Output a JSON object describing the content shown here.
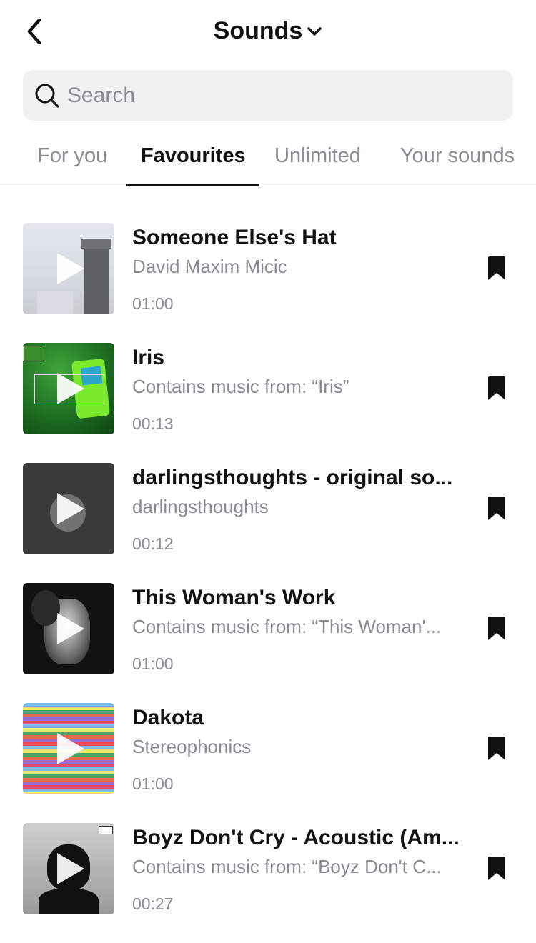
{
  "header": {
    "title": "Sounds"
  },
  "search": {
    "placeholder": "Search"
  },
  "tabs": [
    {
      "label": "For you"
    },
    {
      "label": "Favourites",
      "active": true
    },
    {
      "label": "Unlimited"
    },
    {
      "label": "Your sounds"
    }
  ],
  "sounds": [
    {
      "title": "Someone Else's Hat",
      "subtitle": "David Maxim Micic",
      "duration": "01:00",
      "saved": true
    },
    {
      "title": "Iris",
      "subtitle": "Contains music from: “Iris”",
      "duration": "00:13",
      "saved": true
    },
    {
      "title": "darlingsthoughts - original so...",
      "subtitle": "darlingsthoughts",
      "duration": "00:12",
      "saved": true
    },
    {
      "title": "This Woman's Work",
      "subtitle": "Contains music from: “This Woman'...",
      "duration": "01:00",
      "saved": true
    },
    {
      "title": "Dakota",
      "subtitle": "Stereophonics",
      "duration": "01:00",
      "saved": true
    },
    {
      "title": "Boyz Don't Cry - Acoustic (Am...",
      "subtitle": "Contains music from: “Boyz Don't C...",
      "duration": "00:27",
      "saved": true
    }
  ],
  "colors": {
    "text": "#111111",
    "muted": "#8a8b91",
    "search_bg": "#f1f1f2"
  }
}
